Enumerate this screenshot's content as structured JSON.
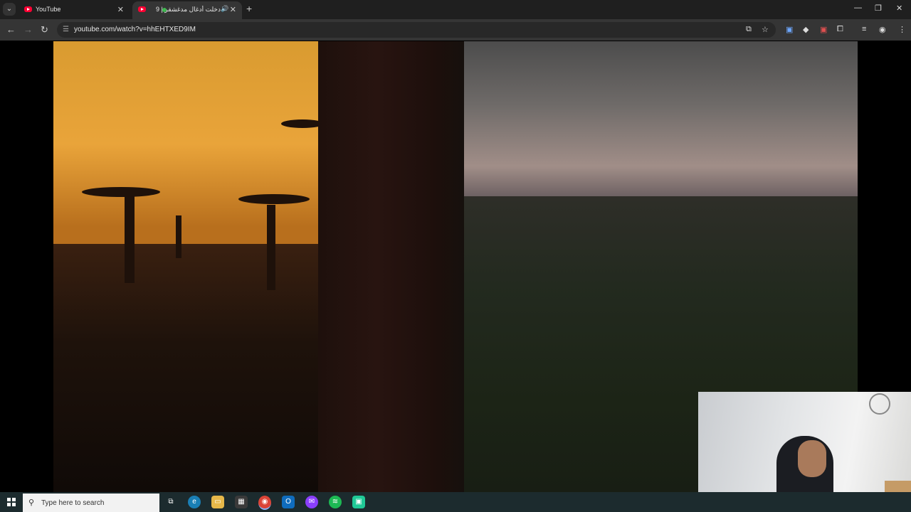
{
  "browser": {
    "tabs": [
      {
        "title": "YouTube",
        "favicon": "youtube-icon",
        "active": false
      },
      {
        "title": "دخلت أدغال مدغشقر | 9",
        "favicon": "youtube-icon",
        "active": true,
        "audio": "speaker-icon"
      }
    ],
    "new_tab": "+",
    "window_controls": {
      "minimize": "—",
      "restore": "❐",
      "close": "✕"
    }
  },
  "toolbar": {
    "back": "←",
    "forward": "→",
    "reload": "↻",
    "url": "youtube.com/watch?v=hhEHTXED9IM"
  },
  "taskbar": {
    "search_placeholder": "Type here to search",
    "apps": [
      "task-view-icon",
      "edge-icon",
      "file-explorer-icon",
      "store-icon",
      "chrome-icon",
      "outlook-icon",
      "messenger-icon",
      "spotify-icon",
      "app-icon"
    ]
  },
  "video": {
    "scene": "baobab-forest-sunset"
  }
}
